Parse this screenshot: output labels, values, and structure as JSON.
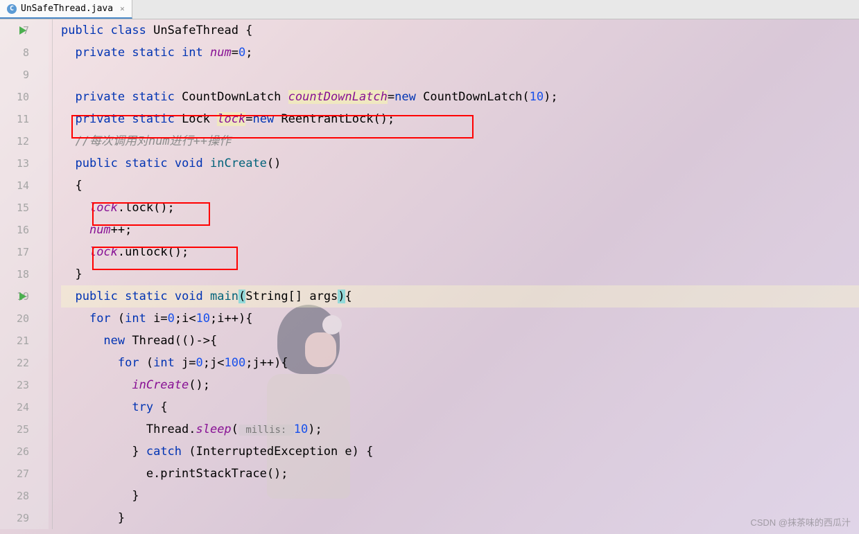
{
  "tab": {
    "filename": "UnSafeThread.java",
    "icon_letter": "C"
  },
  "lines": {
    "7": "7",
    "8": "8",
    "9": "9",
    "10": "10",
    "11": "11",
    "12": "12",
    "13": "13",
    "14": "14",
    "15": "15",
    "16": "16",
    "17": "17",
    "18": "18",
    "19": "19",
    "20": "20",
    "21": "21",
    "22": "22",
    "23": "23",
    "24": "24",
    "25": "25",
    "26": "26",
    "27": "27",
    "28": "28",
    "29": "29"
  },
  "code": {
    "l7_kw1": "public",
    "l7_kw2": "class",
    "l7_name": "UnSafeThread",
    "l7_brace": " {",
    "l8_kw1": "private",
    "l8_kw2": "static",
    "l8_kw3": "int",
    "l8_field": "num",
    "l8_rest": "=",
    "l8_num": "0",
    "l8_semi": ";",
    "l10_kw1": "private",
    "l10_kw2": "static",
    "l10_type": "CountDownLatch",
    "l10_field": "countDownLatch",
    "l10_eq": "=",
    "l10_kw3": "new",
    "l10_ctor": "CountDownLatch(",
    "l10_num": "10",
    "l10_end": ");",
    "l11_kw1": "private",
    "l11_kw2": "static",
    "l11_type": "Lock",
    "l11_field": "lock",
    "l11_eq": "=",
    "l11_kw3": "new",
    "l11_ctor": "ReentrantLock();",
    "l12_comment": "//每次调用对num进行++操作",
    "l13_kw1": "public",
    "l13_kw2": "static",
    "l13_kw3": "void",
    "l13_method": "inCreate",
    "l13_rest": "()",
    "l14_brace": "{",
    "l15_field": "lock",
    "l15_call": ".lock();",
    "l16_field": "num",
    "l16_rest": "++;",
    "l17_field": "lock",
    "l17_call": ".unlock();",
    "l18_brace": "}",
    "l19_kw1": "public",
    "l19_kw2": "static",
    "l19_kw3": "void",
    "l19_method": "main",
    "l19_p1": "(",
    "l19_args": "String[] args",
    "l19_p2": ")",
    "l19_brace": "{",
    "l20_kw1": "for",
    "l20_p": " (",
    "l20_kw2": "int",
    "l20_var": " i=",
    "l20_n0": "0",
    "l20_mid": ";i<",
    "l20_n1": "10",
    "l20_end": ";i++){",
    "l21_kw1": "new",
    "l21_rest": " Thread(()->{",
    "l22_kw1": "for",
    "l22_p": " (",
    "l22_kw2": "int",
    "l22_var": " j=",
    "l22_n0": "0",
    "l22_mid": ";j<",
    "l22_n1": "100",
    "l22_end": ";j++){",
    "l23_call": "inCreate",
    "l23_rest": "();",
    "l24_kw": "try",
    "l24_rest": " {",
    "l25_pre": "Thread.",
    "l25_method": "sleep",
    "l25_open": "(",
    "l25_hint": " millis: ",
    "l25_num": "10",
    "l25_end": ");",
    "l26_close": "} ",
    "l26_kw": "catch",
    "l26_rest": " (InterruptedException e) {",
    "l27_rest": "e.printStackTrace();",
    "l28_brace": "}",
    "l29_brace": "}"
  },
  "watermark": "CSDN @抹茶味的西瓜汁"
}
